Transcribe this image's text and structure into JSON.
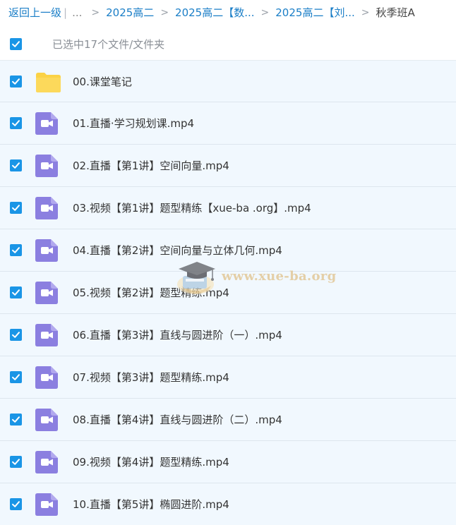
{
  "breadcrumb": {
    "back_label": "返回上一级",
    "separator": "|",
    "ellipsis": "...",
    "arrow": ">",
    "items": [
      "2025高二",
      "2025高二【数...",
      "2025高二【刘..."
    ],
    "current": "秋季班A"
  },
  "selection": {
    "label": "已选中17个文件/文件夹"
  },
  "files": [
    {
      "name": "00.课堂笔记",
      "type": "folder"
    },
    {
      "name": "01.直播·学习规划课.mp4",
      "type": "video"
    },
    {
      "name": "02.直播【第1讲】空间向量.mp4",
      "type": "video"
    },
    {
      "name": "03.视频【第1讲】题型精练【xue-ba .org】.mp4",
      "type": "video"
    },
    {
      "name": "04.直播【第2讲】空间向量与立体几何.mp4",
      "type": "video"
    },
    {
      "name": "05.视频【第2讲】题型精练.mp4",
      "type": "video"
    },
    {
      "name": "06.直播【第3讲】直线与圆进阶（一）.mp4",
      "type": "video"
    },
    {
      "name": "07.视频【第3讲】题型精练.mp4",
      "type": "video"
    },
    {
      "name": "08.直播【第4讲】直线与圆进阶（二）.mp4",
      "type": "video"
    },
    {
      "name": "09.视频【第4讲】题型精练.mp4",
      "type": "video"
    },
    {
      "name": "10.直播【第5讲】椭圆进阶.mp4",
      "type": "video"
    }
  ],
  "watermark": {
    "text": "www.xue-ba.org"
  },
  "colors": {
    "link": "#1a7ec7",
    "checkbox": "#1a95e6",
    "row_bg": "#f1f8fe",
    "video_icon": "#8b7fe0",
    "folder_icon": "#fbd246"
  },
  "icons": {
    "checkbox": "check-icon",
    "folder": "folder-icon",
    "video": "video-file-icon"
  }
}
